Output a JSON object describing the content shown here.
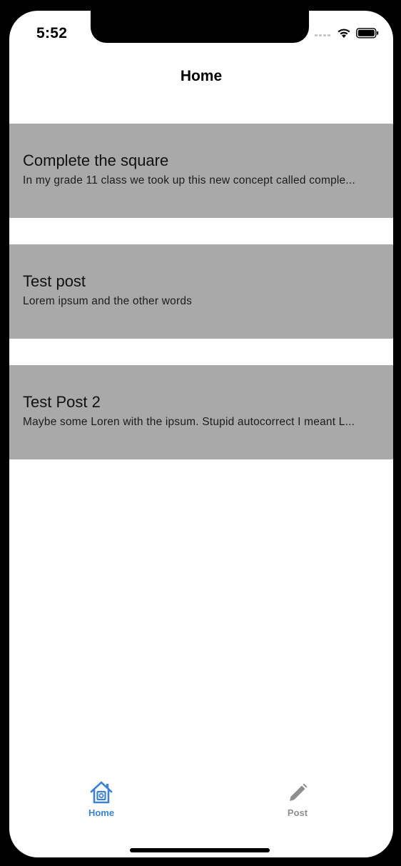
{
  "status_bar": {
    "time": "5:52"
  },
  "nav": {
    "title": "Home"
  },
  "posts": [
    {
      "title": "Complete the square",
      "body": "In my grade 11 class we took up this new concept called comple..."
    },
    {
      "title": "Test post",
      "body": "Lorem ipsum and the other words"
    },
    {
      "title": "Test Post 2",
      "body": "Maybe some Loren with the ipsum. Stupid autocorrect I meant L..."
    }
  ],
  "tab_bar": {
    "tabs": [
      {
        "label": "Home",
        "icon": "home-icon",
        "active": true
      },
      {
        "label": "Post",
        "icon": "pencil-icon",
        "active": false
      }
    ]
  },
  "colors": {
    "card_background": "#a9a9a9",
    "active_tab": "#3b82d6",
    "inactive_tab": "#8e8e8e"
  }
}
